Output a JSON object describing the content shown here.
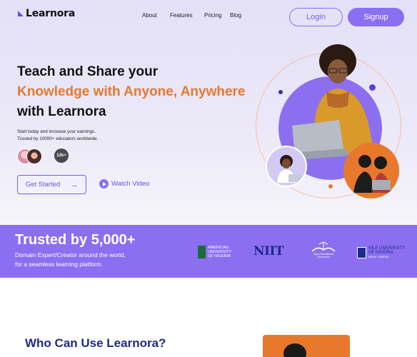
{
  "brand": {
    "name": "Learnora",
    "accent": "#8b6ff0",
    "orange": "#e8792c",
    "navy": "#1e2a8c"
  },
  "nav": {
    "about": "About",
    "features": "Features",
    "pricing": "Pricing",
    "blog": "Blog"
  },
  "auth": {
    "login": "Login",
    "signup": "Signup"
  },
  "hero": {
    "line1": "Teach and Share your",
    "line2": "Knowledge with Anyone, Anywhere",
    "line3": "with Learnora",
    "sub1": "Start today and increase your earnings.",
    "sub2": "Trusted by 10000+ educators worldwide.",
    "count_badge": "12k+",
    "cta_primary": "Get Started",
    "cta_arrow": "→",
    "cta_secondary": "Watch Video"
  },
  "trust": {
    "title": "Trusted by 5,000+",
    "sub1": "Domain Expert/Creator around the world,",
    "sub2": "for a seamless learning platform",
    "partners": {
      "aun_l1": "AMERICAN",
      "aun_l2": "UNIVERSITY",
      "aun_l3": "OF NIGERIA",
      "niit": "NIIT",
      "open_l1": "Open",
      "open_l2": "Educational",
      "open_l3": "Resources",
      "nile_l1": "NILE UNIVERSITY",
      "nile_l2": "OF NIGERIA",
      "nile_l3": "ABUJA · NIGERIA"
    }
  },
  "who": {
    "title": "Who Can Use Learnora?"
  }
}
